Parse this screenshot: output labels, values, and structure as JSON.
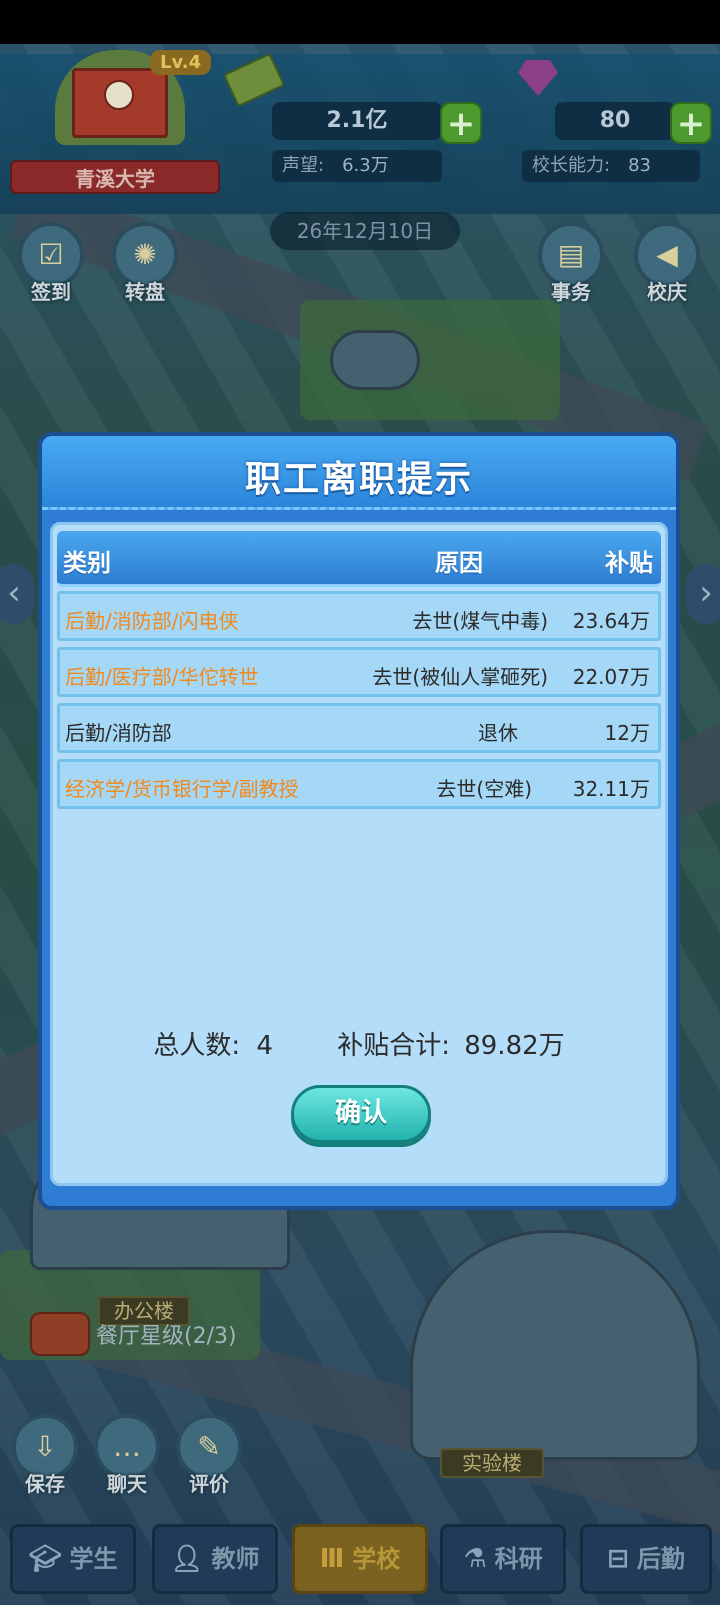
{
  "hud": {
    "school_name": "青溪大学",
    "level": "Lv.4",
    "money": "2.1亿",
    "gems": "80",
    "reputation_label": "声望:",
    "reputation_value": "6.3万",
    "principal_label": "校长能力:",
    "principal_value": "83",
    "date": "26年12月10日"
  },
  "quick_buttons": [
    {
      "label": "签到",
      "icon": "checkin-icon"
    },
    {
      "label": "转盘",
      "icon": "wheel-icon"
    },
    {
      "label": "事务",
      "icon": "clipboard-icon"
    },
    {
      "label": "校庆",
      "icon": "megaphone-icon"
    }
  ],
  "dialog": {
    "title": "职工离职提示",
    "columns": {
      "category": "类别",
      "reason": "原因",
      "subsidy": "补贴"
    },
    "rows": [
      {
        "category": "后勤/消防部/闪电侠",
        "reason": "去世(煤气中毒)",
        "subsidy": "23.64万",
        "highlight": true
      },
      {
        "category": "后勤/医疗部/华佗转世",
        "reason": "去世(被仙人掌砸死)",
        "subsidy": "22.07万",
        "highlight": true
      },
      {
        "category": "后勤/消防部",
        "reason": "退休",
        "subsidy": "12万",
        "highlight": false
      },
      {
        "category": "经济学/货币银行学/副教授",
        "reason": "去世(空难)",
        "subsidy": "32.11万",
        "highlight": true
      }
    ],
    "total_label": "总人数:",
    "total_value": "4",
    "subsidy_total_label": "补贴合计:",
    "subsidy_total_value": "89.82万",
    "confirm_label": "确认"
  },
  "world": {
    "office_label": "办公楼",
    "lab_label": "实验楼",
    "restaurant_label": "餐厅星级(2/3)"
  },
  "side_buttons": [
    {
      "label": "保存",
      "icon": "save-icon"
    },
    {
      "label": "聊天",
      "icon": "chat-icon"
    },
    {
      "label": "评价",
      "icon": "review-icon"
    }
  ],
  "tabs": [
    {
      "label": "学生",
      "icon": "graduation-cap-icon",
      "active": false
    },
    {
      "label": "教师",
      "icon": "teacher-icon",
      "active": false
    },
    {
      "label": "学校",
      "icon": "school-icon",
      "active": true
    },
    {
      "label": "科研",
      "icon": "microscope-icon",
      "active": false
    },
    {
      "label": "后勤",
      "icon": "logistics-icon",
      "active": false
    }
  ],
  "colors": {
    "dialog_blue": "#2e7cd3",
    "highlight_text": "#f08a1d",
    "confirm_button": "#22b3ae",
    "active_tab": "#7b6220"
  }
}
